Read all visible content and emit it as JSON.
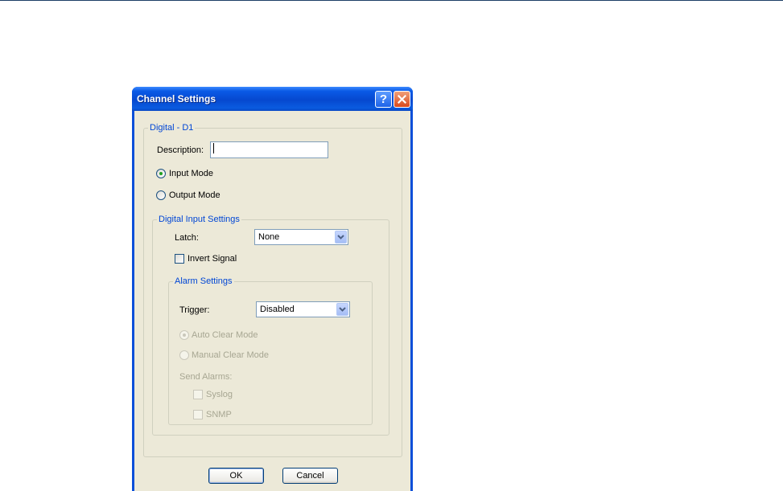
{
  "dialog": {
    "title": "Channel Settings",
    "help_glyph": "?",
    "close_glyph": "✕"
  },
  "channel_group": {
    "legend": "Digital - D1",
    "description_label": "Description:",
    "description_value": "",
    "input_mode_label": "Input Mode",
    "input_mode_selected": true,
    "output_mode_label": "Output Mode",
    "output_mode_selected": false
  },
  "digital_input": {
    "legend": "Digital Input Settings",
    "latch_label": "Latch:",
    "latch_value": "None",
    "invert_label": "Invert Signal",
    "invert_checked": false
  },
  "alarm": {
    "legend": "Alarm Settings",
    "trigger_label": "Trigger:",
    "trigger_value": "Disabled",
    "auto_clear_label": "Auto Clear Mode",
    "auto_clear_selected": true,
    "manual_clear_label": "Manual Clear Mode",
    "manual_clear_selected": false,
    "send_alarms_label": "Send Alarms:",
    "syslog_label": "Syslog",
    "syslog_checked": false,
    "snmp_label": "SNMP",
    "snmp_checked": false
  },
  "buttons": {
    "ok": "OK",
    "cancel": "Cancel"
  },
  "colors": {
    "titlebar": "#0648cf",
    "face": "#ece9d8",
    "group_text": "#0046d5",
    "disabled_text": "#a7a692"
  }
}
